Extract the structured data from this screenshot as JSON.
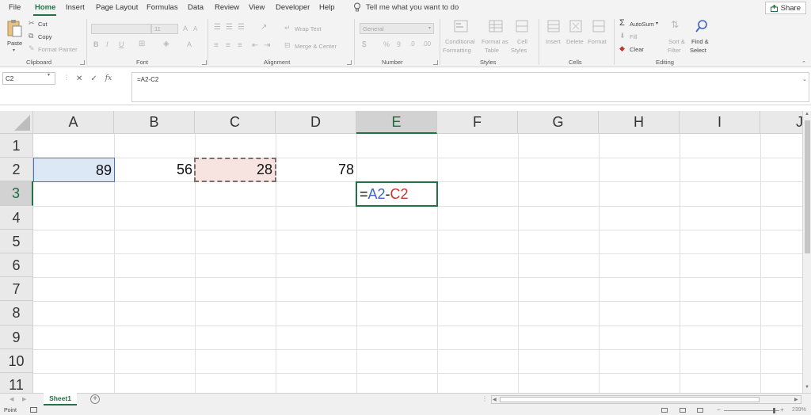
{
  "ribbon_tabs": [
    "File",
    "Home",
    "Insert",
    "Page Layout",
    "Formulas",
    "Data",
    "Review",
    "View",
    "Developer",
    "Help"
  ],
  "active_tab": "Home",
  "tell_me": "Tell me what you want to do",
  "share_label": "Share",
  "clipboard": {
    "paste": "Paste",
    "cut": "Cut",
    "copy": "Copy",
    "format_painter": "Format Painter",
    "group": "Clipboard"
  },
  "font": {
    "size": "11",
    "bold": "B",
    "italic": "I",
    "underline": "U",
    "grow": "A",
    "shrink": "A",
    "color": "A",
    "group": "Font"
  },
  "alignment": {
    "wrap_text": "Wrap Text",
    "merge_center": "Merge & Center",
    "group": "Alignment"
  },
  "number": {
    "format": "General",
    "currency": "$",
    "percent": "%",
    "comma": "9",
    "group": "Number"
  },
  "styles": {
    "conditional_formatting": [
      "Conditional",
      "Formatting"
    ],
    "format_as_table": [
      "Format as",
      "Table"
    ],
    "cell_styles": [
      "Cell",
      "Styles"
    ],
    "group": "Styles"
  },
  "cells": {
    "insert": "Insert",
    "delete": "Delete",
    "format": "Format",
    "group": "Cells"
  },
  "editing": {
    "autosum": "AutoSum",
    "fill": "Fill",
    "clear": "Clear",
    "sort_filter": [
      "Sort &",
      "Filter"
    ],
    "find_select": [
      "Find &",
      "Select"
    ],
    "group": "Editing"
  },
  "formula_bar": {
    "name_box": "C2",
    "fx": "fx",
    "formula": "=A2-C2"
  },
  "columns": [
    "A",
    "B",
    "C",
    "D",
    "E",
    "F",
    "G",
    "H",
    "I",
    "J"
  ],
  "rows": [
    "1",
    "2",
    "3",
    "4",
    "5",
    "6",
    "7",
    "8",
    "9",
    "10",
    "11"
  ],
  "cells_data": {
    "A2": "89",
    "B2": "56",
    "C2": "28",
    "D2": "78",
    "E3": {
      "prefix": "=",
      "ref1": "A2",
      "op": "-",
      "ref2": "C2"
    }
  },
  "sheets": [
    "Sheet1"
  ],
  "status": {
    "mode": "Point",
    "zoom": "239%"
  },
  "colors": {
    "accent": "#217346",
    "ref_blue": "#3b66c4",
    "ref_red": "#c0392b",
    "a2_fill": "#dde8f7",
    "c2_fill": "#f7e3e0"
  }
}
